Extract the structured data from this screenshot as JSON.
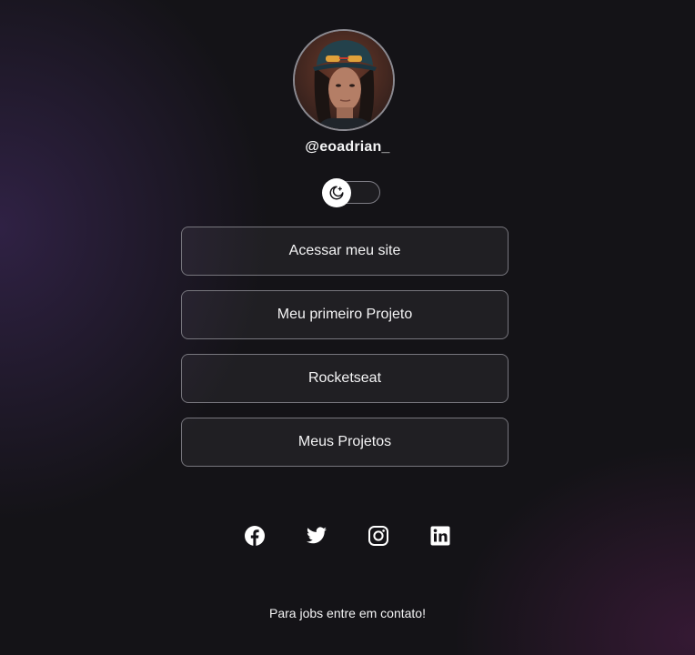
{
  "profile": {
    "username": "@eoadrian_",
    "avatar_alt": "profile photo"
  },
  "theme_switch": {
    "icon": "moon-stars-icon",
    "state": "dark"
  },
  "links": [
    {
      "label": "Acessar meu site"
    },
    {
      "label": "Meu primeiro Projeto"
    },
    {
      "label": "Rocketseat"
    },
    {
      "label": "Meus Projetos"
    }
  ],
  "socials": [
    {
      "icon": "facebook-icon"
    },
    {
      "icon": "twitter-icon"
    },
    {
      "icon": "instagram-icon"
    },
    {
      "icon": "linkedin-icon"
    }
  ],
  "footer": {
    "text": "Para jobs entre em contato!"
  },
  "colors": {
    "background": "#141317",
    "text": "#f4f4f5",
    "button_border": "#77767d",
    "accent_purple": "#462d69"
  }
}
